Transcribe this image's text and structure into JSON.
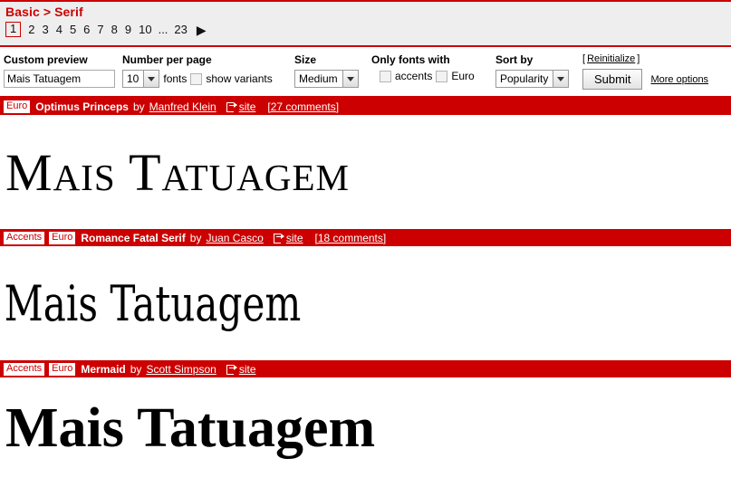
{
  "breadcrumb": "Basic > Serif",
  "pagination": {
    "current": "1",
    "pages": [
      "2",
      "3",
      "4",
      "5",
      "6",
      "7",
      "8",
      "9",
      "10"
    ],
    "ellipsis": "...",
    "last": "23",
    "next_icon": "▶"
  },
  "options": {
    "custom_preview": {
      "label": "Custom preview",
      "value": "Mais Tatuagem",
      "placeholder": ""
    },
    "number_per_page": {
      "label": "Number per page",
      "value": "10",
      "suffix": "fonts",
      "variants_label": "show variants",
      "variants_checked": false
    },
    "size": {
      "label": "Size",
      "value": "Medium"
    },
    "only_fonts_with": {
      "label": "Only fonts with",
      "accents_label": "accents",
      "accents_checked": false,
      "euro_label": "Euro",
      "euro_checked": false
    },
    "sort_by": {
      "label": "Sort by",
      "value": "Popularity"
    },
    "reinitialize_open": "[",
    "reinitialize": "Reinitialize",
    "reinitialize_close": "]",
    "submit": "Submit",
    "more_options": "More options"
  },
  "fonts": [
    {
      "badges": [
        "Euro"
      ],
      "name": "Optimus Princeps",
      "by": "by",
      "author": "Manfred Klein",
      "site": "site",
      "comments": "[27 comments]",
      "preview": "Mais Tatuagem"
    },
    {
      "badges": [
        "Accents",
        "Euro"
      ],
      "name": "Romance Fatal Serif",
      "by": "by",
      "author": "Juan Casco",
      "site": "site",
      "comments": "[18 comments]",
      "preview": "Mais Tatuagem"
    },
    {
      "badges": [
        "Accents",
        "Euro"
      ],
      "name": "Mermaid",
      "by": "by",
      "author": "Scott Simpson",
      "site": "site",
      "comments": "",
      "preview": "Mais Tatuagem"
    }
  ],
  "colors": {
    "brand_red": "#cc0000",
    "bar_bg": "#eeeeee",
    "text": "#000000"
  }
}
